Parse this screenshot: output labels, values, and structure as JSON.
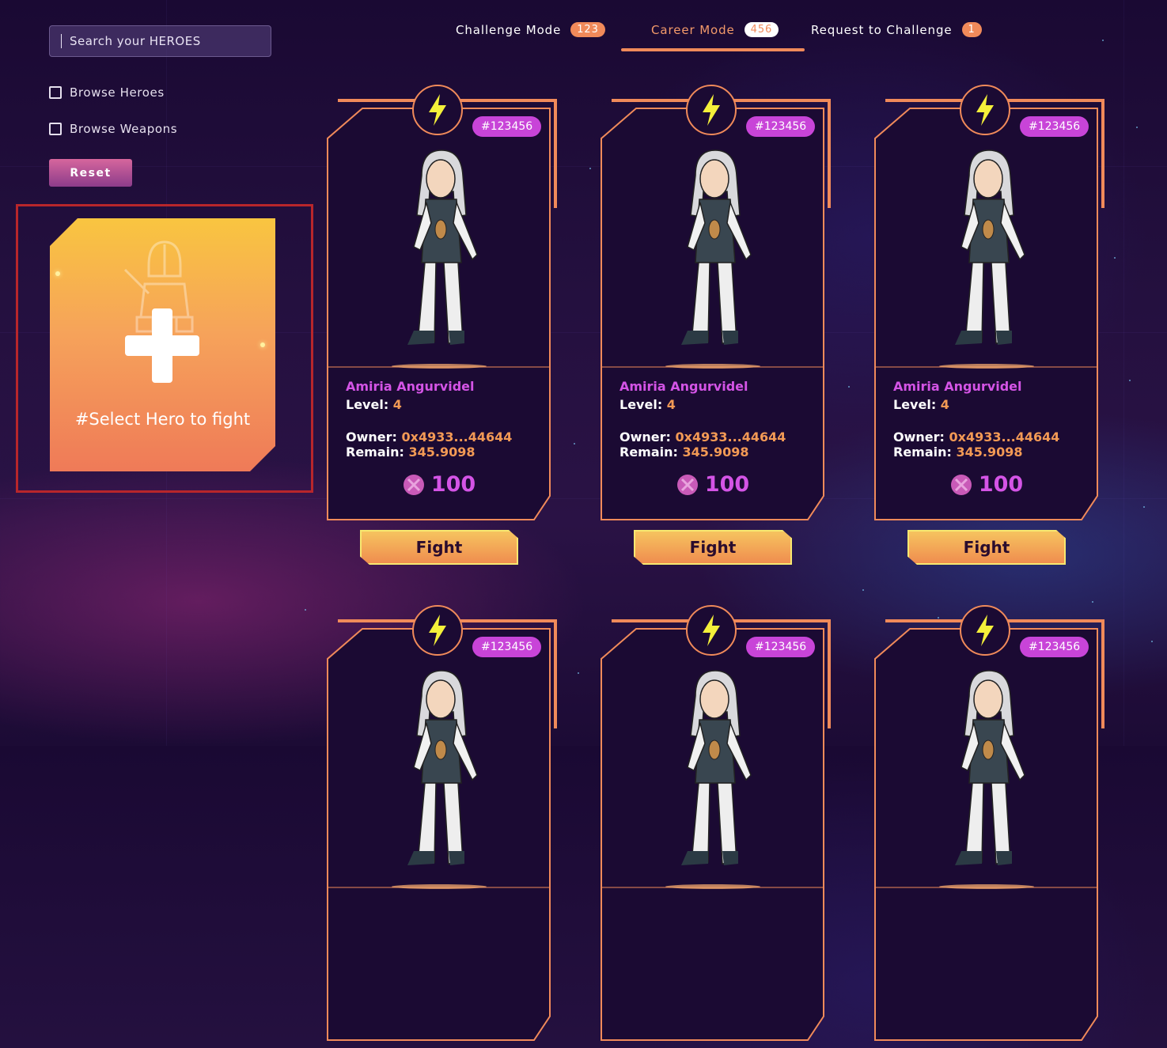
{
  "search": {
    "placeholder": "Search your HEROES"
  },
  "filters": [
    {
      "label": "Browse Heroes",
      "checked": false
    },
    {
      "label": "Browse Weapons",
      "checked": false
    }
  ],
  "reset_label": "Reset",
  "select_card": {
    "label": "#Select Hero to fight"
  },
  "tabs": [
    {
      "label": "Challenge Mode",
      "count": "123",
      "active": false
    },
    {
      "label": "Career Mode",
      "count": "456",
      "active": true
    },
    {
      "label": "Request to Challenge",
      "count": "1",
      "active": false
    }
  ],
  "colors": {
    "accent": "#f08a5a",
    "badge": "#c844d8",
    "name": "#d454e6",
    "value": "#f39a55",
    "highlight": "#b8262b"
  },
  "cards": [
    {
      "id": "#123456",
      "name": "Amiria Angurvidel",
      "level_label": "Level:",
      "level": "4",
      "owner_label": "Owner:",
      "owner": "0x4933...44644",
      "remain_label": "Remain:",
      "remain": "345.9098",
      "price": "100",
      "fight_label": "Fight"
    },
    {
      "id": "#123456",
      "name": "Amiria Angurvidel",
      "level_label": "Level:",
      "level": "4",
      "owner_label": "Owner:",
      "owner": "0x4933...44644",
      "remain_label": "Remain:",
      "remain": "345.9098",
      "price": "100",
      "fight_label": "Fight"
    },
    {
      "id": "#123456",
      "name": "Amiria Angurvidel",
      "level_label": "Level:",
      "level": "4",
      "owner_label": "Owner:",
      "owner": "0x4933...44644",
      "remain_label": "Remain:",
      "remain": "345.9098",
      "price": "100",
      "fight_label": "Fight"
    },
    {
      "id": "#123456"
    },
    {
      "id": "#123456"
    },
    {
      "id": "#123456"
    }
  ]
}
